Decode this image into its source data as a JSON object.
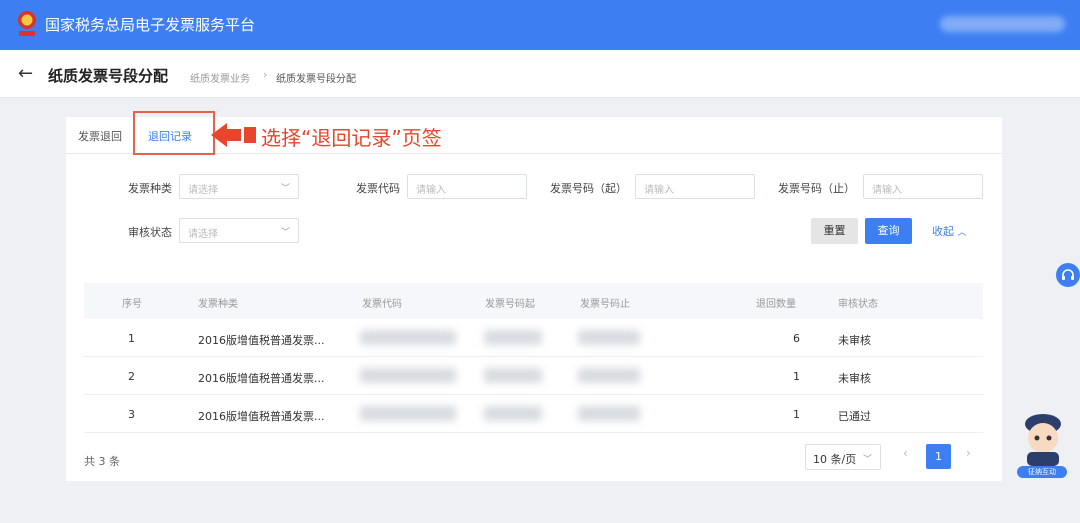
{
  "header": {
    "title": "国家税务总局电子发票服务平台"
  },
  "subheader": {
    "page_title": "纸质发票号段分配",
    "breadcrumb": [
      "纸质发票业务",
      "纸质发票号段分配"
    ],
    "separator": "›"
  },
  "tabs": [
    {
      "label": "发票退回",
      "active": false
    },
    {
      "label": "退回记录",
      "active": true
    }
  ],
  "annotation": {
    "text": "选择“退回记录”页签"
  },
  "filters": {
    "invoice_type": {
      "label": "发票种类",
      "placeholder": "请选择"
    },
    "invoice_code": {
      "label": "发票代码",
      "placeholder": "请输入"
    },
    "number_start": {
      "label": "发票号码（起）",
      "placeholder": "请输入"
    },
    "number_end": {
      "label": "发票号码（止）",
      "placeholder": "请输入"
    },
    "review_status": {
      "label": "审核状态",
      "placeholder": "请选择"
    }
  },
  "buttons": {
    "reset": "重置",
    "query": "查询",
    "collapse": "收起"
  },
  "table": {
    "columns": [
      "序号",
      "发票种类",
      "发票代码",
      "发票号码起",
      "发票号码止",
      "退回数量",
      "审核状态"
    ],
    "rows": [
      {
        "no": "1",
        "type": "2016版增值税普通发票...",
        "qty": "6",
        "status": "未审核"
      },
      {
        "no": "2",
        "type": "2016版增值税普通发票...",
        "qty": "1",
        "status": "未审核"
      },
      {
        "no": "3",
        "type": "2016版增值税普通发票...",
        "qty": "1",
        "status": "已通过"
      }
    ]
  },
  "pagination": {
    "total": "共 3 条",
    "page_size": "10 条/页",
    "current_page": "1",
    "prev": "‹",
    "next": "›"
  },
  "widgets": {
    "assistant_label": "征纳互动"
  },
  "colors": {
    "primary": "#3d7ff3",
    "annotation": "#e8462c"
  }
}
